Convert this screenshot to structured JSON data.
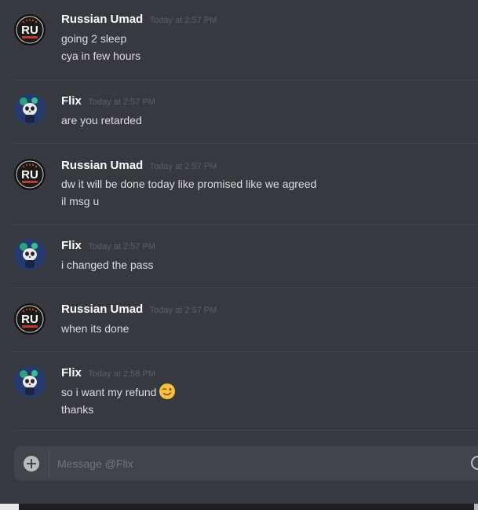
{
  "messages": [
    {
      "author": "Russian Umad",
      "avatar_icon": "ru-logo-avatar",
      "timestamp": "Today at 2:57 PM",
      "lines": [
        "going 2 sleep",
        "cya in few hours"
      ]
    },
    {
      "author": "Flix",
      "avatar_icon": "panda-avatar",
      "timestamp": "Today at 2:57 PM",
      "lines": [
        "are you retarded"
      ]
    },
    {
      "author": "Russian Umad",
      "avatar_icon": "ru-logo-avatar",
      "timestamp": "Today at 2:57 PM",
      "lines": [
        "dw it will be done today like promised like we agreed",
        "il msg u"
      ]
    },
    {
      "author": "Flix",
      "avatar_icon": "panda-avatar",
      "timestamp": "Today at 2:57 PM",
      "lines": [
        "i changed the pass"
      ]
    },
    {
      "author": "Russian Umad",
      "avatar_icon": "ru-logo-avatar",
      "timestamp": "Today at 2:57 PM",
      "lines": [
        "when its done"
      ]
    },
    {
      "author": "Flix",
      "avatar_icon": "panda-avatar",
      "timestamp": "Today at 2:58 PM",
      "lines": [
        "so i want my refund",
        "thanks"
      ],
      "emoji": "winking-face-emoji"
    }
  ],
  "composer": {
    "placeholder": "Message @Flix",
    "add_icon": "plus-circle-icon",
    "emoji_icon": "emoji-picker-icon"
  },
  "colors": {
    "background": "#36393f",
    "username": "#ffffff",
    "timestamp": "#5d6066",
    "message_text": "#dcddde",
    "composer_bg": "#40444b"
  }
}
